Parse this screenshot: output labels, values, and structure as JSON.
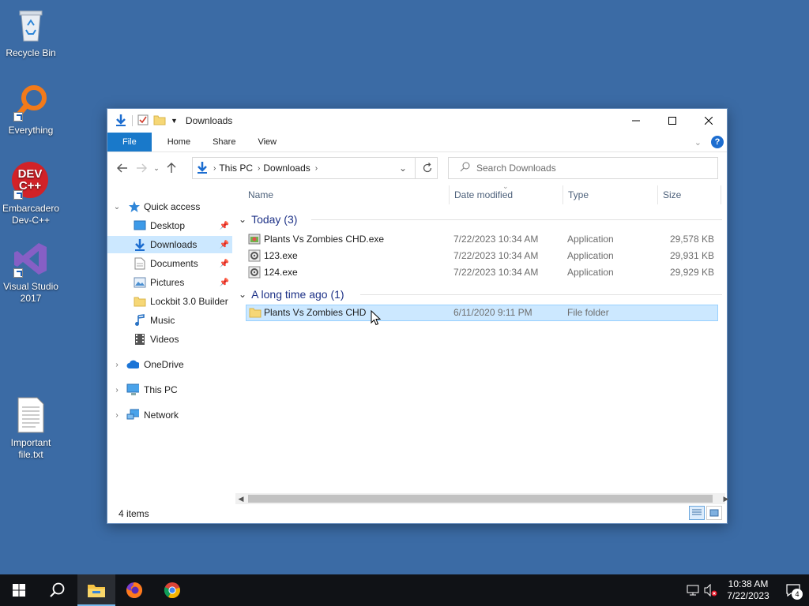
{
  "desktop": {
    "icons": [
      {
        "label": "Recycle Bin",
        "icon": "recycle-bin-icon"
      },
      {
        "label": "Everything",
        "icon": "everything-search-icon"
      },
      {
        "label": "Embarcadero Dev-C++",
        "icon": "devcpp-icon",
        "icon_text_line1": "DEV",
        "icon_text_line2": "C++"
      },
      {
        "label": "Visual Studio 2017",
        "icon": "visual-studio-icon"
      },
      {
        "label": "Important file.txt",
        "icon": "text-file-icon"
      }
    ]
  },
  "window": {
    "title": "Downloads",
    "ribbon_tabs": [
      "File",
      "Home",
      "Share",
      "View"
    ],
    "help_label": "?",
    "address": {
      "segments": [
        "This PC",
        "Downloads"
      ]
    },
    "search_placeholder": "Search Downloads",
    "nav": {
      "quick_access": "Quick access",
      "items": [
        {
          "label": "Desktop",
          "pinned": true
        },
        {
          "label": "Downloads",
          "pinned": true,
          "selected": true
        },
        {
          "label": "Documents",
          "pinned": true
        },
        {
          "label": "Pictures",
          "pinned": true
        },
        {
          "label": "Lockbit 3.0 Builder",
          "pinned": false
        },
        {
          "label": "Music",
          "pinned": false
        },
        {
          "label": "Videos",
          "pinned": false
        }
      ],
      "roots": [
        "OneDrive",
        "This PC",
        "Network"
      ]
    },
    "columns": [
      "Name",
      "Date modified",
      "Type",
      "Size"
    ],
    "groups": [
      {
        "title": "Today (3)",
        "files": [
          {
            "name": "Plants Vs Zombies CHD.exe",
            "date": "7/22/2023 10:34 AM",
            "type": "Application",
            "size": "29,578 KB"
          },
          {
            "name": "123.exe",
            "date": "7/22/2023 10:34 AM",
            "type": "Application",
            "size": "29,931 KB"
          },
          {
            "name": "124.exe",
            "date": "7/22/2023 10:34 AM",
            "type": "Application",
            "size": "29,929 KB"
          }
        ]
      },
      {
        "title": "A long time ago (1)",
        "files": [
          {
            "name": "Plants Vs Zombies CHD",
            "date": "6/11/2020 9:11 PM",
            "type": "File folder",
            "size": ""
          }
        ]
      }
    ],
    "status": "4 items"
  },
  "taskbar": {
    "time": "10:38 AM",
    "date": "7/22/2023",
    "notification_count": "4"
  },
  "colors": {
    "desktop": "#3b6ba5",
    "accent": "#1979ca",
    "selection": "#cce8ff",
    "taskbar": "#101216"
  }
}
